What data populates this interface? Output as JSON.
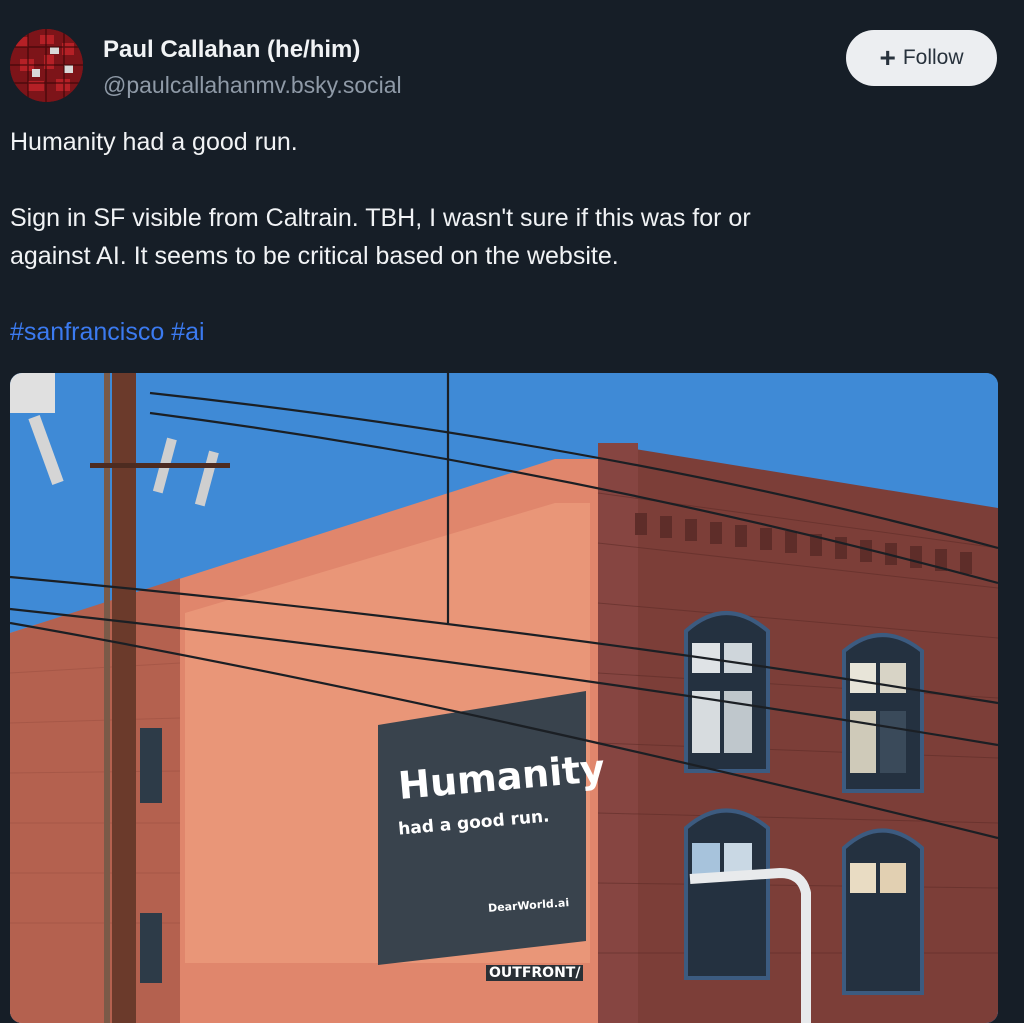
{
  "post": {
    "author": {
      "display_name": "Paul Callahan (he/him)",
      "handle": "@paulcallahanmv.bsky.social"
    },
    "follow_button": {
      "icon": "+",
      "label": "Follow"
    },
    "text": {
      "line1": "Humanity had a good run.",
      "line2": "Sign in SF visible from Caltrain. TBH, I wasn't sure if this was for or",
      "line3": "against AI. It seems to be critical based on the website."
    },
    "hashtags": [
      "#sanfrancisco",
      "#ai"
    ],
    "image": {
      "billboard_headline": "Humanity",
      "billboard_subline": "had a good run.",
      "billboard_site": "DearWorld.ai",
      "billboard_vendor": "OUTFRONT/"
    }
  },
  "colors": {
    "background": "#161e27",
    "text": "#f1f3f5",
    "handle": "#8f9aa7",
    "hashtag": "#3b7af0",
    "follow_bg": "#eceef1"
  }
}
